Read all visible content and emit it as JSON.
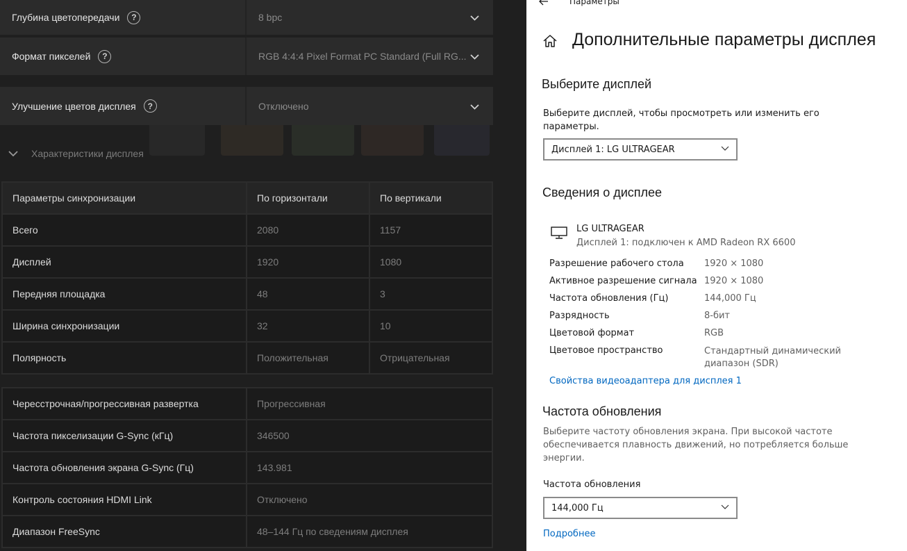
{
  "left_panel": {
    "settings": [
      {
        "label": "Глубина цветопередачи",
        "value": "8 bpc"
      },
      {
        "label": "Формат пикселей",
        "value": "RGB 4:4:4 Pixel Format PC Standard (Full RG..."
      },
      {
        "label": "Улучшение цветов дисплея",
        "value": "Отключено"
      }
    ],
    "section_title": "Характеристики дисплея",
    "timing_table": {
      "headers": [
        "Параметры синхронизации",
        "По горизонтали",
        "По вертикали"
      ],
      "rows": [
        [
          "Всего",
          "2080",
          "1157"
        ],
        [
          "Дисплей",
          "1920",
          "1080"
        ],
        [
          "Передняя площадка",
          "48",
          "3"
        ],
        [
          "Ширина синхронизации",
          "32",
          "10"
        ],
        [
          "Полярность",
          "Положительная",
          "Отрицательная"
        ]
      ]
    },
    "props_table": [
      [
        "Чересстрочная/прогрессивная развертка",
        "Прогрессивная"
      ],
      [
        "Частота пикселизации G-Sync (кГц)",
        "346500"
      ],
      [
        "Частота обновления экрана G-Sync (Гц)",
        "143.981"
      ],
      [
        "Контроль состояния HDMI Link",
        "Отключено"
      ],
      [
        "Диапазон FreeSync",
        "48–144 Гц по сведениям дисплея"
      ]
    ]
  },
  "right_panel": {
    "breadcrumb": "Параметры",
    "page_title": "Дополнительные параметры дисплея",
    "select_display": {
      "heading": "Выберите дисплей",
      "description_line1": "Выберите дисплей, чтобы просмотреть или изменить его",
      "description_line2": "параметры.",
      "dropdown_value": "Дисплей 1: LG ULTRAGEAR"
    },
    "display_info": {
      "heading": "Сведения о дисплее",
      "monitor_name": "LG ULTRAGEAR",
      "monitor_sub": "Дисплей 1: подключен к AMD Radeon RX 6600",
      "rows": [
        {
          "k": "Разрешение рабочего стола",
          "v": "1920 × 1080"
        },
        {
          "k": "Активное разрешение сигнала",
          "v": "1920 × 1080"
        },
        {
          "k": "Частота обновления (Гц)",
          "v": "144,000 Гц"
        },
        {
          "k": "Разрядность",
          "v": "8-бит"
        },
        {
          "k": "Цветовой формат",
          "v": "RGB"
        },
        {
          "k": "Цветовое пространство",
          "v": "Стандартный динамический",
          "v2": "диапазон (SDR)"
        }
      ],
      "adapter_link": "Свойства видеоадаптера для дисплея 1"
    },
    "refresh": {
      "heading": "Частота обновления",
      "desc_line1": "Выберите частоту обновления экрана. При высокой частоте",
      "desc_line2": "обеспечивается плавность движений, но потребляется больше",
      "desc_line3": "энергии.",
      "label": "Частота обновления",
      "dropdown_value": "144,000 Гц",
      "more_link": "Подробнее"
    }
  }
}
